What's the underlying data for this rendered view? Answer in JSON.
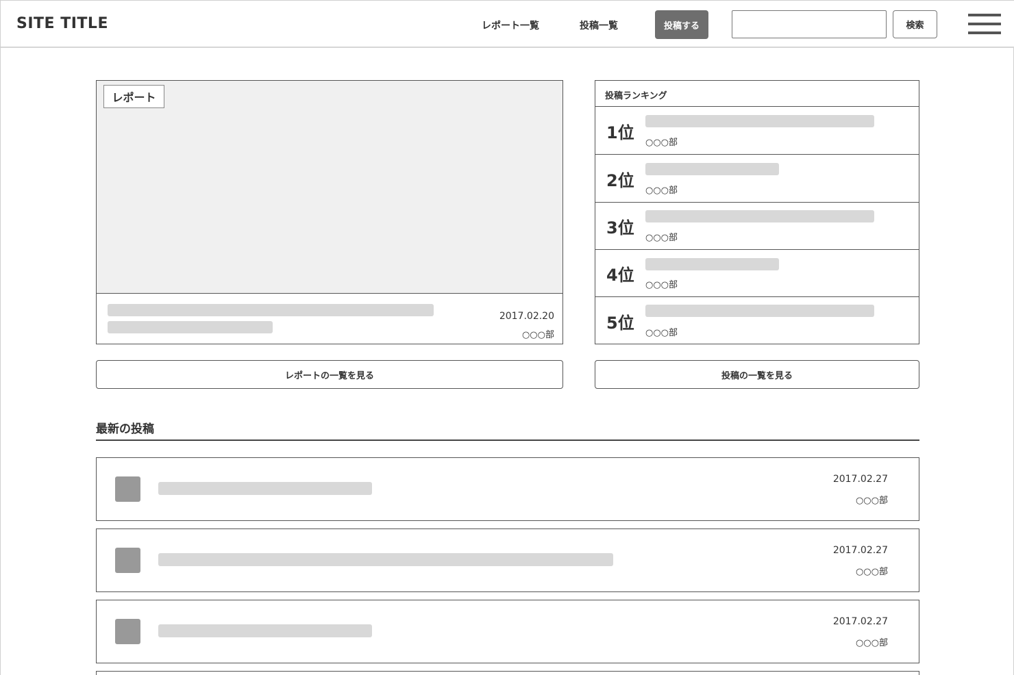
{
  "header": {
    "site_title": "SITE TITLE",
    "nav": {
      "reports": "レポート一覧",
      "posts": "投稿一覧"
    },
    "post_button": "投稿する",
    "search": {
      "value": "",
      "placeholder": "",
      "button": "検索"
    }
  },
  "featured_report": {
    "tag": "レポート",
    "date": "2017.02.20",
    "dept": "○○○部"
  },
  "ranking": {
    "title": "投稿ランキング",
    "items": [
      {
        "rank": "1位",
        "dept": "○○○部"
      },
      {
        "rank": "2位",
        "dept": "○○○部"
      },
      {
        "rank": "3位",
        "dept": "○○○部"
      },
      {
        "rank": "4位",
        "dept": "○○○部"
      },
      {
        "rank": "5位",
        "dept": "○○○部"
      }
    ]
  },
  "buttons": {
    "view_reports": "レポートの一覧を見る",
    "view_posts": "投稿の一覧を見る"
  },
  "latest": {
    "title": "最新の投稿",
    "items": [
      {
        "date": "2017.02.27",
        "dept": "○○○部"
      },
      {
        "date": "2017.02.27",
        "dept": "○○○部"
      },
      {
        "date": "2017.02.27",
        "dept": "○○○部"
      }
    ]
  }
}
